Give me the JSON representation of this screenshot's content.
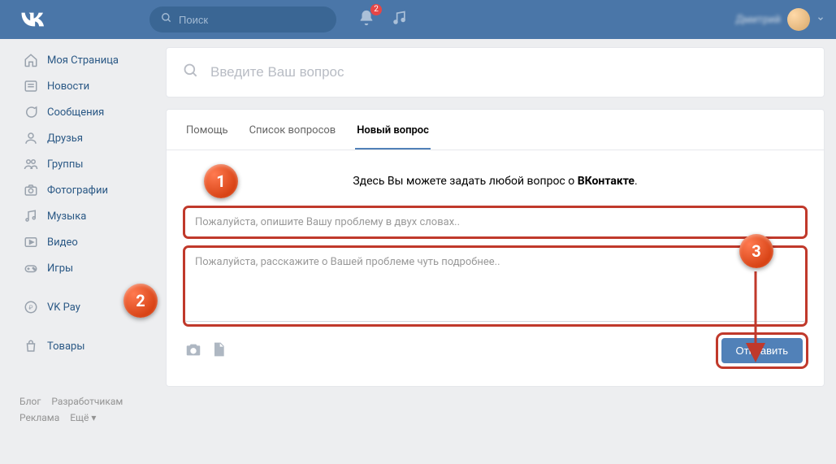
{
  "header": {
    "search_placeholder": "Поиск",
    "notification_count": "2",
    "user_name": "Дмитрий"
  },
  "sidebar": {
    "items": [
      {
        "label": "Моя Страница"
      },
      {
        "label": "Новости"
      },
      {
        "label": "Сообщения"
      },
      {
        "label": "Друзья"
      },
      {
        "label": "Группы"
      },
      {
        "label": "Фотографии"
      },
      {
        "label": "Музыка"
      },
      {
        "label": "Видео"
      },
      {
        "label": "Игры"
      }
    ],
    "extra": [
      {
        "label": "VK Pay"
      },
      {
        "label": "Товары"
      }
    ]
  },
  "footer": {
    "links": [
      "Блог",
      "Разработчикам",
      "Реклама",
      "Ещё ▾"
    ]
  },
  "main": {
    "search_placeholder": "Введите Ваш вопрос",
    "tabs": [
      {
        "label": "Помощь"
      },
      {
        "label": "Список вопросов"
      },
      {
        "label": "Новый вопрос"
      }
    ],
    "heading_prefix": "Здесь Вы можете задать любой вопрос о ",
    "heading_brand": "ВКонтакте",
    "heading_suffix": ".",
    "subject_placeholder": "Пожалуйста, опишите Вашу проблему в двух словах..",
    "body_placeholder": "Пожалуйста, расскажите о Вашей проблеме чуть подробнее..",
    "submit_label": "Отправить"
  },
  "callouts": {
    "c1": "1",
    "c2": "2",
    "c3": "3"
  },
  "colors": {
    "brand_blue": "#4a76a8",
    "button_blue": "#5181b8",
    "highlight_red": "#c0392b",
    "callout_orange": "#e64a19"
  }
}
